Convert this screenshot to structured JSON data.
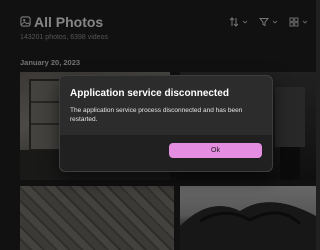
{
  "header": {
    "title": "All Photos",
    "subtitle": "143201 photos, 6398 videos"
  },
  "toolbar": {
    "sort_icon": "sort-arrows-icon",
    "filter_icon": "filter-funnel-icon",
    "view_icon": "view-layout-icon"
  },
  "gallery": {
    "date_group": "January 20, 2023"
  },
  "dialog": {
    "title": "Application service disconnected",
    "message": "The application service process disconnected and has been restarted.",
    "ok_label": "Ok",
    "accent": "#e58de0"
  }
}
